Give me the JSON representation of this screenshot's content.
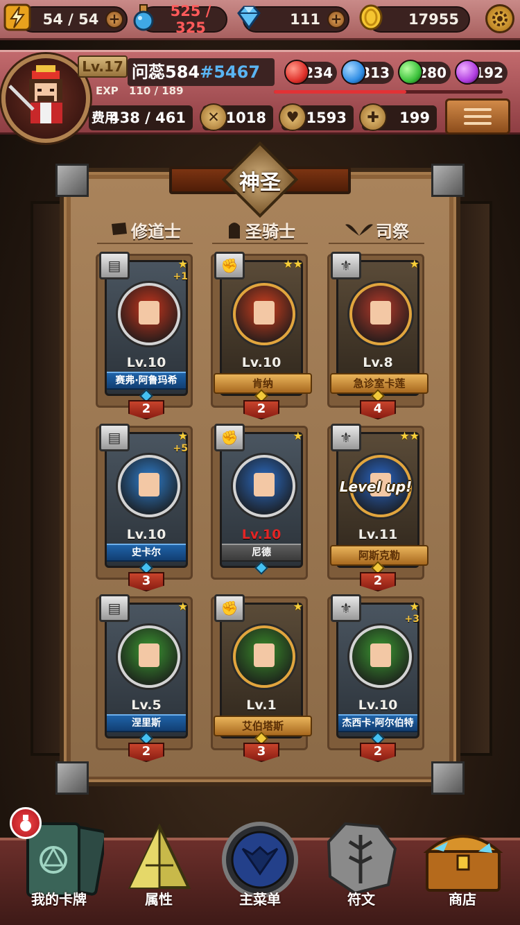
{
  "resources": {
    "stamina": {
      "icon": "lightning-icon",
      "value": "54 / 54"
    },
    "potion": {
      "icon": "potion-icon",
      "value": "525 / 325",
      "color": "#ff5a5a"
    },
    "diamond": {
      "icon": "diamond-icon",
      "value": "111"
    },
    "gold": {
      "icon": "gold-coin-icon",
      "value": "17955"
    }
  },
  "profile": {
    "level": "Lv.17",
    "name": "问蕊584",
    "tag": "#5467",
    "exp_label": "EXP",
    "exp_value": "110 / 189",
    "exp_fraction": 0.58,
    "orbs": [
      {
        "icon": "red-orb-icon",
        "value": "234",
        "color": "#e0322c"
      },
      {
        "icon": "blue-orb-icon",
        "value": "313",
        "color": "#2f8de4"
      },
      {
        "icon": "green-orb-icon",
        "value": "280",
        "color": "#3cc23c"
      },
      {
        "icon": "purple-orb-icon",
        "value": "192",
        "color": "#b03ee0"
      }
    ],
    "cost_label": "费用",
    "cost_value": "438 / 461",
    "attack": "1018",
    "health": "1593",
    "heal": "199"
  },
  "board": {
    "title": "神圣",
    "columns": [
      {
        "label": "修道士",
        "icon": "flag-icon"
      },
      {
        "label": "圣骑士",
        "icon": "knight-helmet-icon"
      },
      {
        "label": "司祭",
        "icon": "wings-icon"
      }
    ],
    "cards": [
      {
        "level": "Lv.10",
        "name": "赛弗·阿鲁玛希",
        "stars": "★",
        "plus": "+1",
        "count": "2",
        "style": "blue",
        "class_icon": "book-icon",
        "portrait_color": "#c8361e"
      },
      {
        "level": "Lv.10",
        "name": "肯纳",
        "stars": "★★",
        "plus": "",
        "count": "2",
        "style": "gold",
        "class_icon": "fist-icon",
        "portrait_color": "#d2401f"
      },
      {
        "level": "Lv.8",
        "name": "急诊室卡莲",
        "stars": "★",
        "plus": "",
        "count": "4",
        "style": "gold",
        "class_icon": "wings-icon",
        "portrait_color": "#b63a2a"
      },
      {
        "level": "Lv.10",
        "name": "史卡尔",
        "stars": "★",
        "plus": "+5",
        "count": "3",
        "style": "blue",
        "class_icon": "book-icon",
        "portrait_color": "#2f7fcf"
      },
      {
        "level": "Lv.10",
        "name": "尼德",
        "stars": "★",
        "plus": "",
        "count": "",
        "style": "grey",
        "class_icon": "fist-icon",
        "portrait_color": "#2c6cc4",
        "level_red": true
      },
      {
        "level": "Lv.11",
        "name": "阿斯克勒",
        "stars": "★★",
        "plus": "",
        "count": "2",
        "style": "gold",
        "class_icon": "wings-icon",
        "portrait_color": "#2a67c8",
        "levelup": "Level up!"
      },
      {
        "level": "Lv.5",
        "name": "涅里斯",
        "stars": "★",
        "plus": "",
        "count": "2",
        "style": "blue",
        "class_icon": "book-icon",
        "portrait_color": "#3c9a32"
      },
      {
        "level": "Lv.1",
        "name": "艾伯塔斯",
        "stars": "★",
        "plus": "",
        "count": "3",
        "style": "gold",
        "class_icon": "fist-icon",
        "portrait_color": "#3b8d2b"
      },
      {
        "level": "Lv.10",
        "name": "杰西卡·阿尔伯特",
        "stars": "★",
        "plus": "+3",
        "count": "2",
        "style": "blue",
        "class_icon": "wings-icon",
        "portrait_color": "#3c9a32"
      }
    ]
  },
  "nav": {
    "items": [
      {
        "label": "我的卡牌",
        "icon": "card-deck-icon"
      },
      {
        "label": "属性",
        "icon": "triangle-crystal-icon"
      },
      {
        "label": "主菜单",
        "icon": "emblem-icon"
      },
      {
        "label": "符文",
        "icon": "rune-stone-icon"
      },
      {
        "label": "商店",
        "icon": "treasure-chest-icon"
      }
    ],
    "alert_icon": "potion-alert-icon"
  }
}
